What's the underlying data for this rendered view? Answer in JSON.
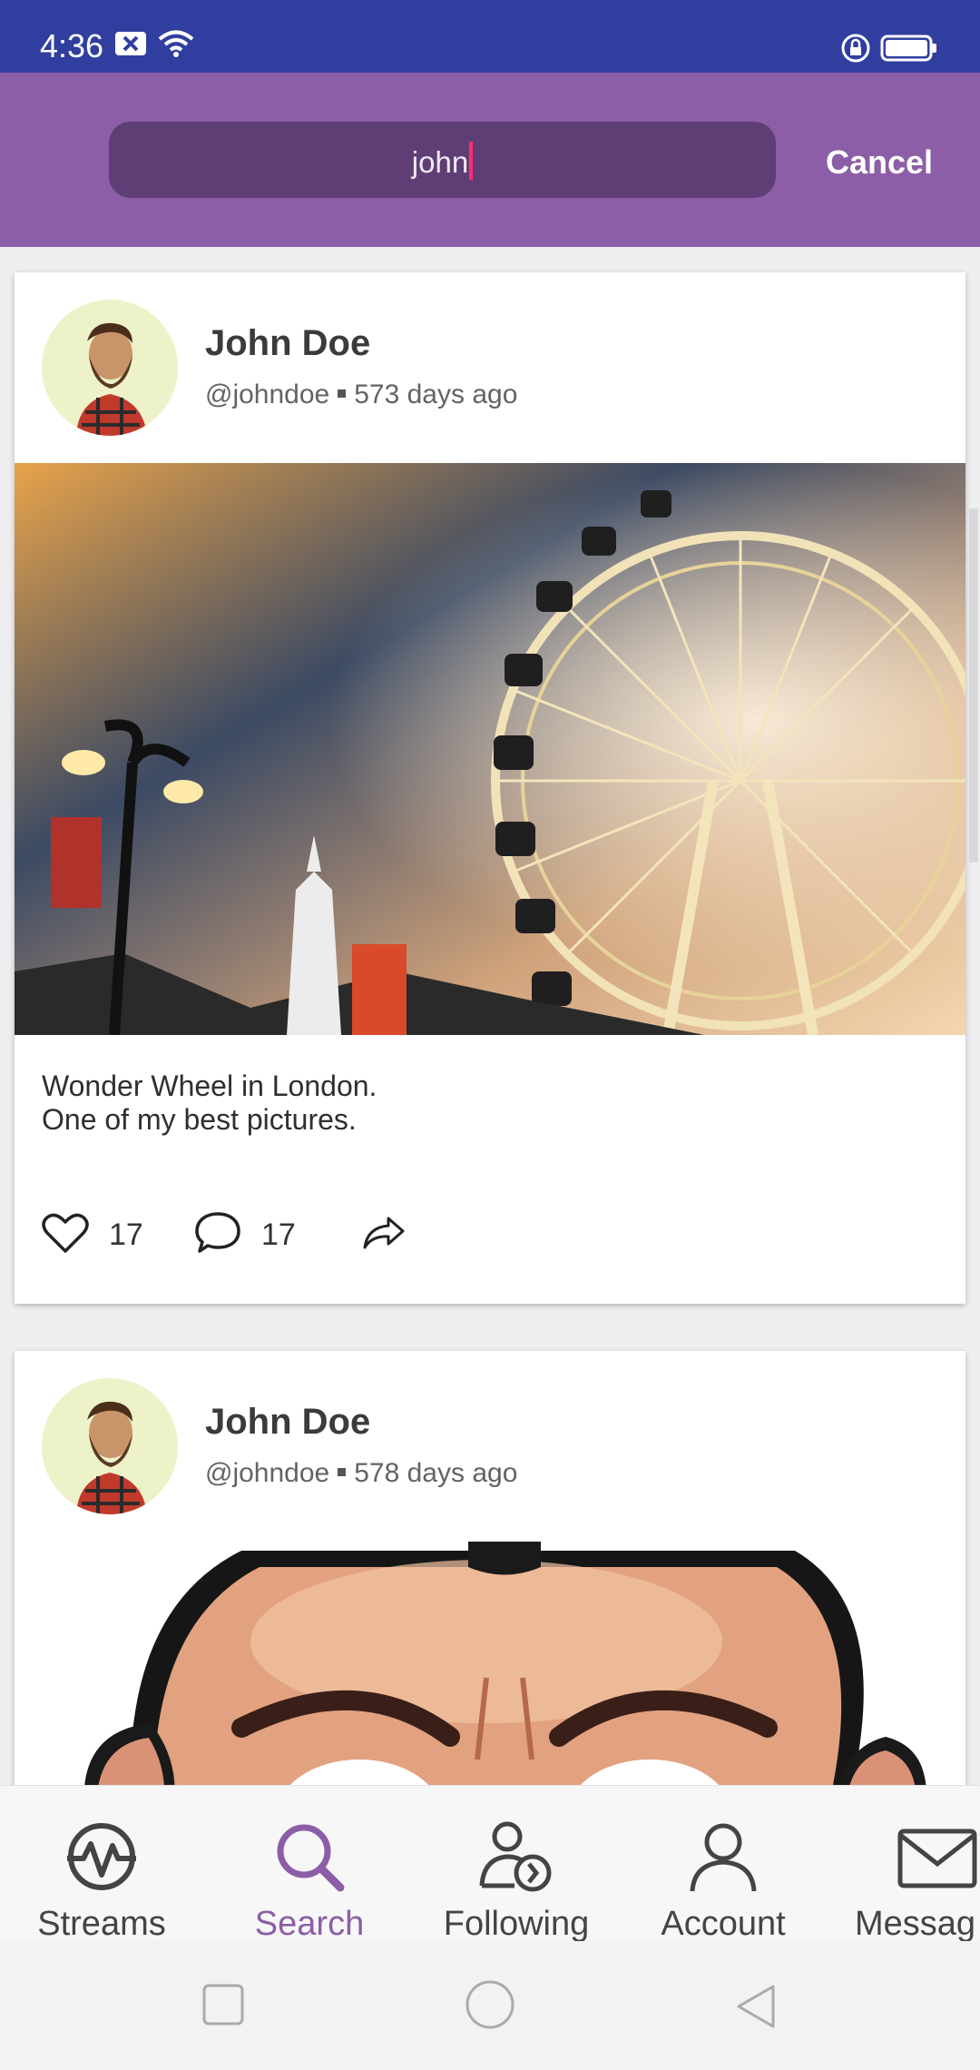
{
  "status_bar": {
    "time": "4:36",
    "icons": [
      "close-box-icon",
      "wifi-icon",
      "lock-icon",
      "battery-icon"
    ]
  },
  "search": {
    "value": "john",
    "cancel_label": "Cancel"
  },
  "posts": [
    {
      "author": "John Doe",
      "handle": "@johndoe",
      "time_ago": "573 days ago",
      "text_line1": "Wonder Wheel in London.",
      "text_line2": "One of my best pictures.",
      "likes": "17",
      "comments": "17",
      "image": "ferris-wheel-photo"
    },
    {
      "author": "John Doe",
      "handle": "@johndoe",
      "time_ago": "578 days ago",
      "image": "cartoon-face-illustration"
    }
  ],
  "bottom_nav": {
    "items": [
      {
        "label": "Streams",
        "icon": "streams-icon"
      },
      {
        "label": "Search",
        "icon": "search-icon",
        "active": true
      },
      {
        "label": "Following",
        "icon": "following-icon"
      },
      {
        "label": "Account",
        "icon": "account-icon"
      },
      {
        "label": "Messag",
        "icon": "mail-icon"
      }
    ]
  },
  "colors": {
    "status_bar": "#303f9f",
    "header": "#8b5ea7",
    "search_box": "#5f3e76",
    "caret": "#ff2b73",
    "active_nav": "#8b5ea7"
  }
}
